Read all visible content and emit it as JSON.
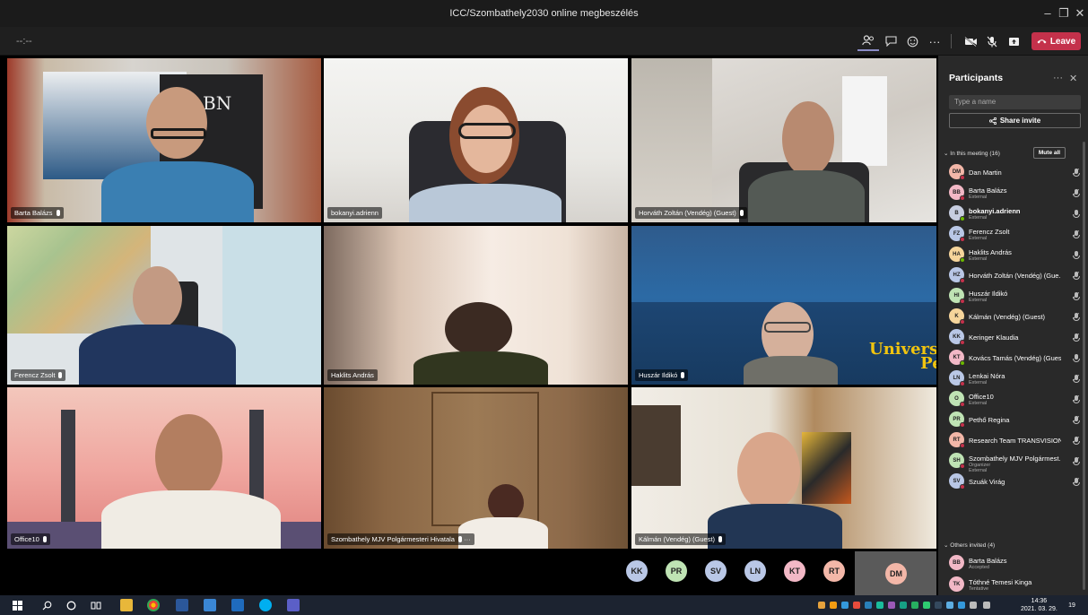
{
  "window": {
    "title": "ICC/Szombathely2030 online megbeszélés",
    "minimize": "–",
    "restore": "❐",
    "close": "✕"
  },
  "toolbar": {
    "timer": "--:--",
    "participants_icon": "people-icon",
    "chat_icon": "chat-icon",
    "reactions_icon": "reactions-icon",
    "more": "···",
    "camera_icon": "camera-off-icon",
    "mic_icon": "mic-off-icon",
    "share_icon": "share-tray-icon",
    "leave_label": "Leave"
  },
  "tiles": [
    {
      "name": "Barta Balázs",
      "mic": true
    },
    {
      "name": "bokanyi.adrienn",
      "mic": false
    },
    {
      "name": "Horváth Zoltán (Vendég) (Guest)",
      "mic": true
    },
    {
      "name": "Ferencz Zsolt",
      "mic": true
    },
    {
      "name": "Haklits András",
      "mic": false
    },
    {
      "name": "Huszár Ildikó",
      "mic": true
    },
    {
      "name": "Office10",
      "mic": true
    },
    {
      "name": "Szombathely MJV Polgármesteri Hivatala",
      "mic": true
    },
    {
      "name": "Kálmán (Vendég) (Guest)",
      "mic": true
    }
  ],
  "tile_extras": {
    "bn_logo": "BN",
    "university_line1": "University",
    "university_line2": "Pécs",
    "more": "···"
  },
  "avatars": [
    {
      "initials": "KK",
      "color": "#b9c7e6"
    },
    {
      "initials": "PR",
      "color": "#bfe3b4"
    },
    {
      "initials": "SV",
      "color": "#b9c7e6"
    },
    {
      "initials": "LN",
      "color": "#b9c7e6"
    },
    {
      "initials": "KT",
      "color": "#f2b8c6"
    },
    {
      "initials": "RT",
      "color": "#f3b7a8"
    }
  ],
  "self_avatar": {
    "initials": "DM",
    "color": "#f3b7a8"
  },
  "panel": {
    "title": "Participants",
    "more": "···",
    "close": "✕",
    "search_placeholder": "Type a name",
    "share_invite": "Share invite",
    "in_meeting": "In this meeting (16)",
    "mute_all": "Mute all",
    "others_invited": "Others invited (4)",
    "participants": [
      {
        "initials": "DM",
        "color": "#f3b7a8",
        "name": "Dan Martin",
        "sub": "",
        "sub2": "",
        "mic": "muted",
        "bold": false
      },
      {
        "initials": "BB",
        "color": "#f2b8c6",
        "name": "Barta Balázs",
        "sub": "External",
        "sub2": "",
        "mic": "muted",
        "bold": false
      },
      {
        "initials": "B",
        "color": "#c7cde0",
        "name": "bokanyi.adrienn",
        "sub": "External",
        "sub2": "",
        "mic": "on",
        "bold": true
      },
      {
        "initials": "FZ",
        "color": "#b9c7e6",
        "name": "Ferencz Zsolt",
        "sub": "External",
        "sub2": "",
        "mic": "muted",
        "bold": false
      },
      {
        "initials": "HA",
        "color": "#f6d59b",
        "name": "Haklits András",
        "sub": "External",
        "sub2": "",
        "mic": "on",
        "bold": false
      },
      {
        "initials": "HZ",
        "color": "#b9c7e6",
        "name": "Horváth Zoltán (Vendég) (Gue...",
        "sub": "",
        "sub2": "",
        "mic": "muted",
        "bold": false
      },
      {
        "initials": "HI",
        "color": "#bfe3b4",
        "name": "Huszár Ildikó",
        "sub": "External",
        "sub2": "",
        "mic": "muted",
        "bold": false
      },
      {
        "initials": "K",
        "color": "#f6d59b",
        "name": "Kálmán (Vendég) (Guest)",
        "sub": "",
        "sub2": "",
        "mic": "muted",
        "bold": false
      },
      {
        "initials": "KK",
        "color": "#b9c7e6",
        "name": "Keringer Klaudia",
        "sub": "",
        "sub2": "",
        "mic": "muted",
        "bold": false
      },
      {
        "initials": "KT",
        "color": "#f2b8c6",
        "name": "Kovács Tamás (Vendég) (Guest)",
        "sub": "",
        "sub2": "",
        "mic": "on",
        "bold": false
      },
      {
        "initials": "LN",
        "color": "#b9c7e6",
        "name": "Lenkai Nóra",
        "sub": "External",
        "sub2": "",
        "mic": "muted",
        "bold": false
      },
      {
        "initials": "O",
        "color": "#bfe3b4",
        "name": "Office10",
        "sub": "External",
        "sub2": "",
        "mic": "muted",
        "bold": false
      },
      {
        "initials": "PR",
        "color": "#bfe3b4",
        "name": "Pethő Regina",
        "sub": "",
        "sub2": "",
        "mic": "muted",
        "bold": false
      },
      {
        "initials": "RT",
        "color": "#f3b7a8",
        "name": "Research Team TRANSVISION...",
        "sub": "",
        "sub2": "",
        "mic": "muted",
        "bold": false
      },
      {
        "initials": "SH",
        "color": "#bfe3b4",
        "name": "Szombathely MJV Polgármest...",
        "sub": "Organizer",
        "sub2": "External",
        "mic": "muted",
        "bold": false
      },
      {
        "initials": "SV",
        "color": "#b9c7e6",
        "name": "Szuák Virág",
        "sub": "",
        "sub2": "",
        "mic": "muted",
        "bold": false
      }
    ],
    "invited": [
      {
        "initials": "BB",
        "color": "#f2b8c6",
        "name": "Barta Balázs",
        "sub": "Accepted"
      },
      {
        "initials": "TK",
        "color": "#f2b8c6",
        "name": "Tóthné Temesi Kinga",
        "sub": "Tentative"
      }
    ]
  },
  "taskbar": {
    "start_icon": "windows-icon",
    "search_icon": "search-icon",
    "cortana_icon": "cortana-icon",
    "taskview_icon": "task-view-icon",
    "clock_time": "14:36",
    "clock_date": "2021. 03. 29.",
    "notif_badge": "19"
  },
  "colors": {
    "leave": "#c4314b",
    "panel_bg": "#292929",
    "taskbar_bg": "#1c2330"
  }
}
